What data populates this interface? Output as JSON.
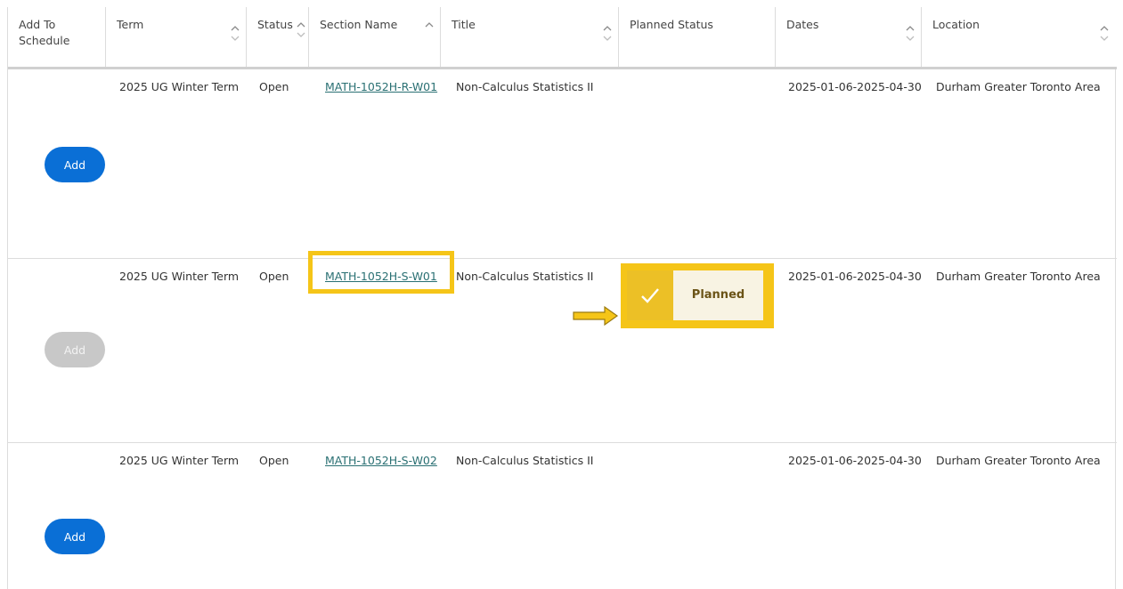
{
  "columns": {
    "add_to_schedule": "Add To Schedule",
    "term": "Term",
    "status": "Status",
    "section_name": "Section Name",
    "title": "Title",
    "planned_status": "Planned Status",
    "dates": "Dates",
    "location": "Location"
  },
  "rows": [
    {
      "term": "2025 UG Winter Term",
      "status": "Open",
      "section": "MATH-1052H-R-W01",
      "title": "Non-Calculus Statistics II",
      "planned_status": "",
      "dates": "2025-01-06-2025-04-30",
      "location": "Durham Greater Toronto Area",
      "add_label": "Add",
      "add_enabled": true
    },
    {
      "term": "2025 UG Winter Term",
      "status": "Open",
      "section": "MATH-1052H-S-W01",
      "title": "Non-Calculus Statistics II",
      "planned_status": "Planned",
      "dates": "2025-01-06-2025-04-30",
      "location": "Durham Greater Toronto Area",
      "add_label": "Add",
      "add_enabled": false
    },
    {
      "term": "2025 UG Winter Term",
      "status": "Open",
      "section": "MATH-1052H-S-W02",
      "title": "Non-Calculus Statistics II",
      "planned_status": "",
      "dates": "2025-01-06-2025-04-30",
      "location": "Durham Greater Toronto Area",
      "add_label": "Add",
      "add_enabled": true
    }
  ],
  "icons": {
    "sort": "sort-up-down-icon",
    "planned_check": "checkmark-icon",
    "annotation_arrow": "arrow-right-icon"
  },
  "colors": {
    "primary_button": "#0a6fd6",
    "disabled_button": "#c8c8c8",
    "highlight": "#f5c518",
    "link": "#2a7073",
    "planned_bg": "#f8f3e3"
  }
}
